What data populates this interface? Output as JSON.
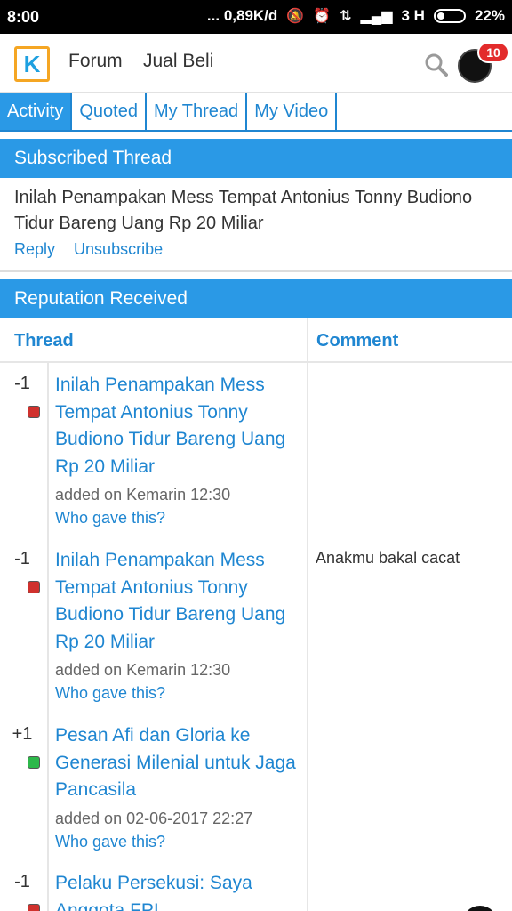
{
  "status_bar": {
    "time": "8:00",
    "speed": "... 0,89K/d",
    "network": "3 H",
    "battery": "22%"
  },
  "header": {
    "logo_glyph": "K",
    "nav": [
      "Forum",
      "Jual Beli"
    ],
    "notification_count": "10"
  },
  "tabs": [
    "Activity",
    "Quoted",
    "My Thread",
    "My Video"
  ],
  "subscribed": {
    "heading": "Subscribed Thread",
    "thread_title": "Inilah Penampakan Mess Tempat Antonius Tonny Budiono Tidur Bareng Uang Rp 20 Miliar",
    "reply_label": "Reply",
    "unsubscribe_label": "Unsubscribe"
  },
  "reputation": {
    "heading": "Reputation Received",
    "col_thread": "Thread",
    "col_comment": "Comment",
    "rows": [
      {
        "value": "-1",
        "type": "negative",
        "thread": "Inilah Penampakan Mess Tempat Antonius Tonny Budiono Tidur Bareng Uang Rp 20 Miliar",
        "added": "added on Kemarin 12:30",
        "who": "Who gave this?",
        "comment": ""
      },
      {
        "value": "-1",
        "type": "negative",
        "thread": "Inilah Penampakan Mess Tempat Antonius Tonny Budiono Tidur Bareng Uang Rp 20 Miliar",
        "added": "added on Kemarin 12:30",
        "who": "Who gave this?",
        "comment": "Anakmu bakal cacat"
      },
      {
        "value": "+1",
        "type": "positive",
        "thread": "Pesan Afi dan Gloria ke Generasi Milenial untuk Jaga Pancasila",
        "added": "added on 02-06-2017 22:27",
        "who": "Who gave this?",
        "comment": ""
      },
      {
        "value": "-1",
        "type": "negative",
        "thread": "Pelaku Persekusi: Saya Anggota FPI",
        "added": "",
        "who": "",
        "comment": ""
      }
    ]
  },
  "colors": {
    "accent": "#2a99e6",
    "link": "#1f86d1",
    "negative": "#d0312d",
    "positive": "#2db84a",
    "badge": "#e32b2b"
  }
}
